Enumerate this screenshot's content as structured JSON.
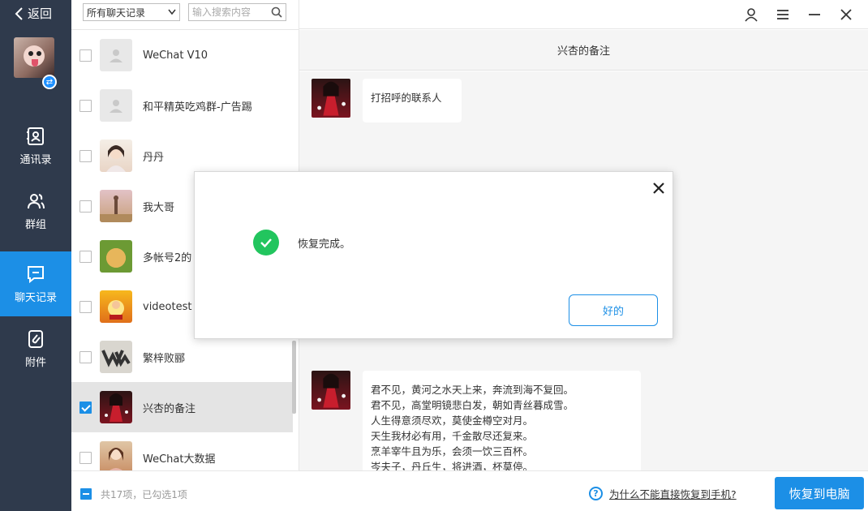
{
  "nav": {
    "back_label": "返回",
    "items": [
      {
        "label": "通讯录",
        "icon": "contacts-icon"
      },
      {
        "label": "群组",
        "icon": "group-icon"
      },
      {
        "label": "聊天记录",
        "icon": "chat-icon"
      },
      {
        "label": "附件",
        "icon": "attachment-icon"
      }
    ],
    "active_index": 2
  },
  "list": {
    "filter_value": "所有聊天记录",
    "search_placeholder": "输入搜索内容",
    "rows": [
      {
        "name": "WeChat V10",
        "checked": false
      },
      {
        "name": "和平精英吃鸡群-广告踢",
        "checked": false
      },
      {
        "name": "丹丹",
        "checked": false
      },
      {
        "name": "我大哥",
        "checked": false
      },
      {
        "name": "多帐号2的",
        "checked": false
      },
      {
        "name": "videotest",
        "checked": false
      },
      {
        "name": "繁梓败郦",
        "checked": false
      },
      {
        "name": "兴杏的备注",
        "checked": true
      },
      {
        "name": "WeChat大数据",
        "checked": false
      }
    ]
  },
  "chat": {
    "title": "兴杏的备注",
    "messages": [
      {
        "lines": [
          "打招呼的联系人"
        ]
      },
      {
        "lines": [
          "君不见，黄河之水天上来，奔流到海不复回。",
          "君不见，高堂明镜悲白发，朝如青丝暮成雪。",
          "人生得意须尽欢，莫使金樽空对月。",
          "天生我材必有用，千金散尽还复来。",
          "烹羊宰牛且为乐，会须一饮三百杯。",
          "岑夫子，丹丘生，将进酒，杯莫停。"
        ]
      }
    ]
  },
  "footer": {
    "count_text": "共17项，已勾选1项",
    "help_text": "为什么不能直接恢复到手机?",
    "restore_label": "恢复到电脑"
  },
  "dialog": {
    "message": "恢复完成。",
    "ok_label": "好的"
  },
  "colors": {
    "nav_bg": "#2f3a4c",
    "accent": "#1c8fe6",
    "success": "#22c55e"
  }
}
